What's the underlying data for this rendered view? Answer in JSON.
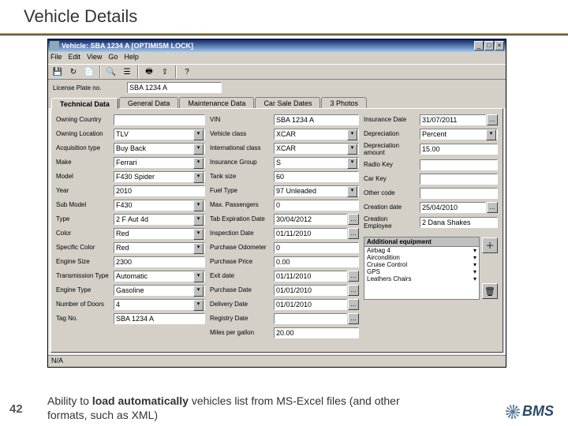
{
  "slide": {
    "title": "Vehicle Details",
    "page": "42",
    "caption_a": "Ability to ",
    "caption_b": "load automatically",
    "caption_c": " vehicles list from MS-Excel files (and other formats, such as XML)",
    "logo": "BMS"
  },
  "win": {
    "title": "Vehicle: SBA 1234 A [OPTIMISM LOCK]"
  },
  "menu": [
    "File",
    "Edit",
    "View",
    "Go",
    "Help"
  ],
  "lp": {
    "label": "License Plate no.",
    "value": "SBA 1234 A"
  },
  "tabs": [
    "Technical Data",
    "General Data",
    "Maintenance Data",
    "Car Sale Dates",
    "3 Photos"
  ],
  "c1": {
    "owning_country": {
      "l": "Owning Country",
      "v": ""
    },
    "owning_location": {
      "l": "Owning Location",
      "v": "TLV"
    },
    "acquisition": {
      "l": "Acquisition type",
      "v": "Buy Back"
    },
    "make": {
      "l": "Make",
      "v": "Ferrari"
    },
    "model": {
      "l": "Model",
      "v": "F430 Spider"
    },
    "year": {
      "l": "Year",
      "v": "2010"
    },
    "submodel": {
      "l": "Sub Model",
      "v": "F430"
    },
    "type": {
      "l": "Type",
      "v": "2 F Aut 4d"
    },
    "color": {
      "l": "Color",
      "v": "Red"
    },
    "specific_color": {
      "l": "Specific Color",
      "v": "Red"
    },
    "engine_size": {
      "l": "Engine Size",
      "v": "2300"
    },
    "transmission": {
      "l": "Transmission Type",
      "v": "Automatic"
    },
    "engine_type": {
      "l": "Engine Type",
      "v": "Gasoline"
    },
    "doors": {
      "l": "Number of Doors",
      "v": "4"
    },
    "tag": {
      "l": "Tag No.",
      "v": "SBA 1234 A"
    }
  },
  "c2": {
    "vin": {
      "l": "VIN",
      "v": "SBA 1234 A"
    },
    "vclass": {
      "l": "Vehicle class",
      "v": "XCAR"
    },
    "iclass": {
      "l": "International class",
      "v": "XCAR"
    },
    "igroup": {
      "l": "Insurance Group",
      "v": "S"
    },
    "tank": {
      "l": "Tank size",
      "v": "60"
    },
    "fuel": {
      "l": "Fuel Type",
      "v": "97 Unleaded"
    },
    "maxp": {
      "l": "Max. Passengers",
      "v": "0"
    },
    "tabexp": {
      "l": "Tab Expiration Date",
      "v": "30/04/2012"
    },
    "insp": {
      "l": "Inspection Date",
      "v": "01/11/2010"
    },
    "podo": {
      "l": "Purchase Odometer",
      "v": "0"
    },
    "pprice": {
      "l": "Purchase Price",
      "v": "0.00"
    },
    "exit": {
      "l": "Exit date",
      "v": "01/11/2010"
    },
    "pdate": {
      "l": "Purchase Date",
      "v": "01/01/2010"
    },
    "ddate": {
      "l": "Delivery Date",
      "v": "01/01/2010"
    },
    "rdate": {
      "l": "Registry Date",
      "v": ""
    },
    "mpg": {
      "l": "Miles per gallon",
      "v": "20.00"
    }
  },
  "c3": {
    "ins": {
      "l": "Insurance Date",
      "v": "31/07/2011"
    },
    "dep": {
      "l": "Depreciation",
      "v": "Percent"
    },
    "depamt": {
      "l": "Depreciation amount",
      "v": "15.00"
    },
    "radio": {
      "l": "Radio Key",
      "v": ""
    },
    "carkey": {
      "l": "Car Key",
      "v": ""
    },
    "other": {
      "l": "Other code",
      "v": ""
    },
    "cdate": {
      "l": "Creation date",
      "v": "25/04/2010"
    },
    "cemp": {
      "l": "Creation Employee",
      "v": "2 Dana Shakes"
    }
  },
  "equip": {
    "header": "Additional equipment",
    "items": [
      "Airbag 4",
      "Aircondition",
      "Cruise Control",
      "GPS",
      "Leathers Chairs"
    ]
  },
  "status": "N/A"
}
